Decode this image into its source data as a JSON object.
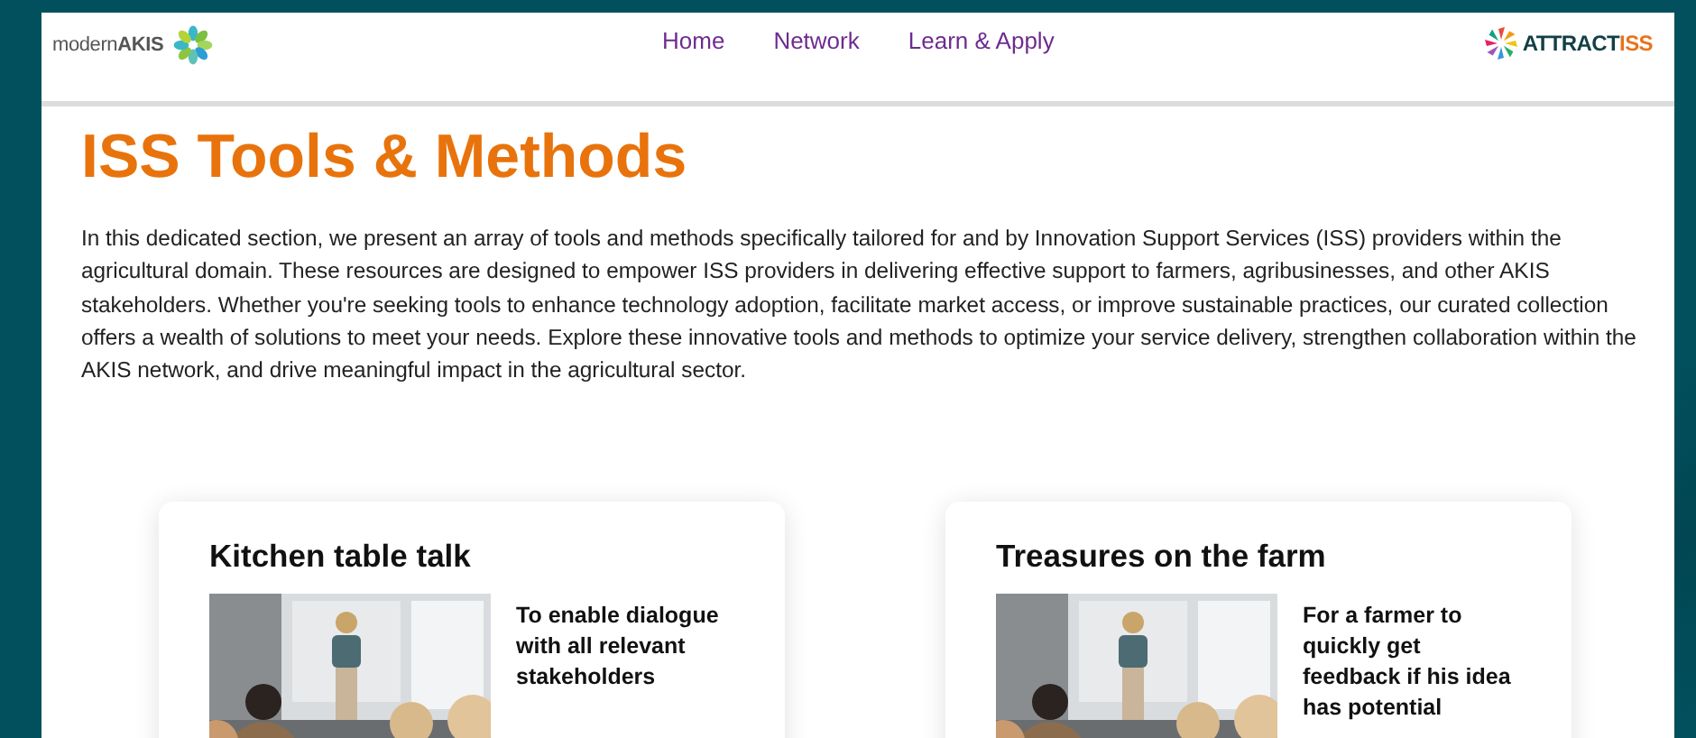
{
  "header": {
    "logo_left": "modern**AKIS**",
    "nav": [
      {
        "label": "Home"
      },
      {
        "label": "Network"
      },
      {
        "label": "Learn & Apply"
      }
    ],
    "logo_right": {
      "text": "ATTRACT",
      "accent": "ISS"
    }
  },
  "title": "ISS Tools & Methods",
  "intro": "In this dedicated section, we present an array of tools and methods specifically tailored for and by Innovation Support Services (ISS) providers within the agricultural domain. These resources are designed to empower ISS providers in delivering effective support to farmers, agribusinesses, and other AKIS stakeholders. Whether you're seeking tools to enhance technology adoption, facilitate market access, or improve sustainable practices, our curated collection offers a wealth of solutions to meet your needs. Explore these innovative tools and methods to optimize your service delivery, strengthen collaboration within the AKIS network, and drive meaningful impact in the agricultural sector.",
  "cards": [
    {
      "title": "Kitchen table talk",
      "description": "To enable dialogue with all relevant stakeholders"
    },
    {
      "title": "Treasures on the farm",
      "description": "For a farmer to quickly get feedback if his idea has potential"
    }
  ]
}
